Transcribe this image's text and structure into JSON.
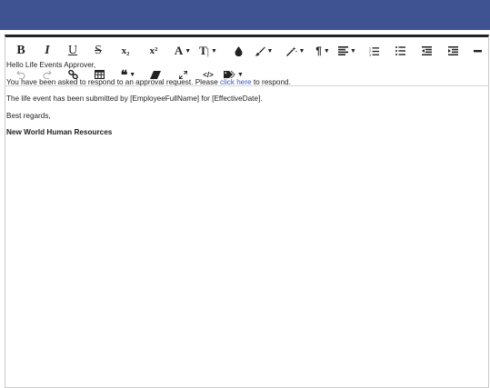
{
  "toolbar": {
    "row1": [
      {
        "name": "bold-button",
        "glyph": "B"
      },
      {
        "name": "italic-button",
        "glyph": "I"
      },
      {
        "name": "underline-button",
        "glyph": "U"
      },
      {
        "name": "strikethrough-button",
        "glyph": "S"
      },
      {
        "name": "subscript-button",
        "glyph": "x₂"
      },
      {
        "name": "superscript-button",
        "glyph": "x²"
      },
      {
        "name": "font-family-dropdown",
        "glyph": "A"
      },
      {
        "name": "font-size-dropdown",
        "glyph": "T"
      },
      {
        "name": "text-color-button",
        "icon": "drop-icon"
      },
      {
        "name": "highlight-color-dropdown",
        "icon": "brush-icon"
      },
      {
        "name": "format-painter-dropdown",
        "icon": "magic-wand-icon"
      },
      {
        "name": "paragraph-format-dropdown",
        "glyph": "¶"
      },
      {
        "name": "align-dropdown",
        "icon": "align-icon"
      },
      {
        "name": "ordered-list-button",
        "icon": "numbered-list-icon"
      },
      {
        "name": "unordered-list-button",
        "icon": "bullet-list-icon"
      },
      {
        "name": "outdent-button",
        "icon": "outdent-icon"
      },
      {
        "name": "indent-button",
        "icon": "indent-icon"
      },
      {
        "name": "horizontal-rule-button",
        "icon": "minus-icon"
      }
    ],
    "row2": [
      {
        "name": "undo-button",
        "icon": "undo-icon"
      },
      {
        "name": "redo-button",
        "icon": "redo-icon"
      },
      {
        "name": "insert-link-button",
        "icon": "link-icon"
      },
      {
        "name": "insert-table-button",
        "icon": "table-icon"
      },
      {
        "name": "quote-dropdown",
        "glyph": "❝"
      },
      {
        "name": "clear-formatting-button",
        "icon": "eraser-icon"
      },
      {
        "name": "fullscreen-button",
        "icon": "expand-icon"
      },
      {
        "name": "code-view-button",
        "glyph": "</>"
      },
      {
        "name": "merge-tags-dropdown",
        "icon": "tag-icon"
      }
    ]
  },
  "content": {
    "greeting": "Hello Life Events Approver,",
    "line2_before": "You have been asked to respond to an approval request. Please ",
    "line2_link": "click here",
    "line2_after": " to respond.",
    "line3": "The life event has been submitted by [EmployeeFullName] for [EffectiveDate].",
    "closing": "Best regards,",
    "signature": "New World Human Resources"
  },
  "colors": {
    "header": "#3f5291",
    "link": "#3a57b8",
    "text": "#222222"
  }
}
